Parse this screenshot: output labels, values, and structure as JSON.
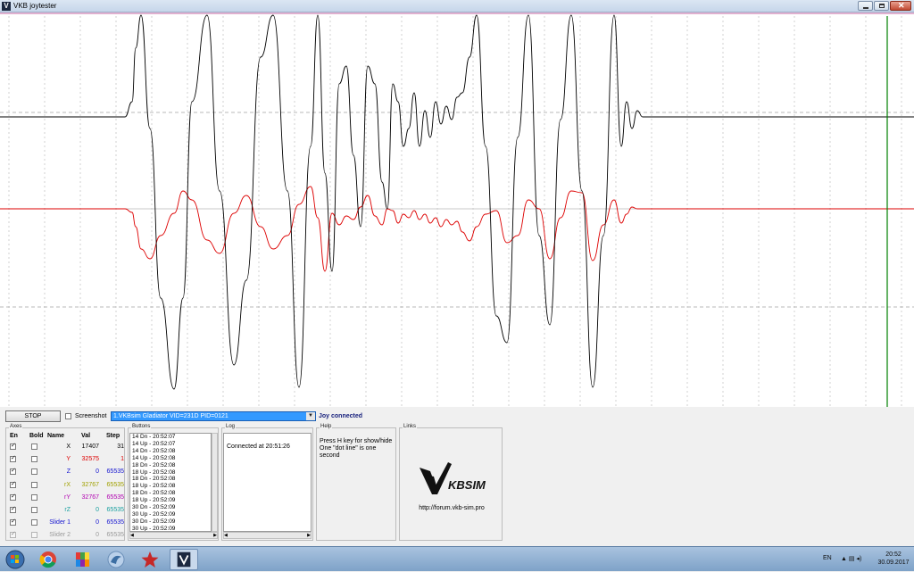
{
  "window": {
    "title": "VKB joytester"
  },
  "plot": {
    "trace_colors": {
      "x": "#000000",
      "y": "#dd0000"
    },
    "cursor_color": "#008000"
  },
  "controls": {
    "stop_label": "STOP",
    "screenshot_label": "Screenshot",
    "screenshot_checked": false,
    "device": "1.VKBsim Gladiator  VID=231D PID=0121",
    "status": "Joy connected",
    "status_color": "#1a237e"
  },
  "axes": {
    "legend": "Axes",
    "headers": {
      "en": "En",
      "bold": "Bold",
      "name": "Name",
      "val": "Val",
      "step": "Step"
    },
    "rows": [
      {
        "name": "X",
        "val": "17407",
        "step": "31",
        "en": true,
        "bold": false,
        "color": "#000000"
      },
      {
        "name": "Y",
        "val": "32575",
        "step": "1",
        "en": true,
        "bold": false,
        "color": "#dd0000"
      },
      {
        "name": "Z",
        "val": "0",
        "step": "65535",
        "en": true,
        "bold": false,
        "color": "#1515d0"
      },
      {
        "name": "rX",
        "val": "32767",
        "step": "65535",
        "en": true,
        "bold": false,
        "color": "#a0a000"
      },
      {
        "name": "rY",
        "val": "32767",
        "step": "65535",
        "en": true,
        "bold": false,
        "color": "#b000b0"
      },
      {
        "name": "rZ",
        "val": "0",
        "step": "65535",
        "en": true,
        "bold": false,
        "color": "#1aa0a0"
      },
      {
        "name": "Slider 1",
        "val": "0",
        "step": "65535",
        "en": true,
        "bold": false,
        "color": "#1515d0"
      },
      {
        "name": "Slider 2",
        "val": "0",
        "step": "65535",
        "en": true,
        "bold": false,
        "color": "#9a9a9a"
      }
    ]
  },
  "buttons": {
    "legend": "Buttons",
    "events": [
      "14 Dn - 20:52:07",
      "14 Up - 20:52:07",
      "14 Dn - 20:52:08",
      "14 Up - 20:52:08",
      "18 Dn - 20:52:08",
      "18 Up - 20:52:08",
      "18 Dn - 20:52:08",
      "18 Up - 20:52:08",
      "18 Dn - 20:52:08",
      "18 Up - 20:52:09",
      "30 Dn - 20:52:09",
      "30 Up - 20:52:09",
      "30 Dn - 20:52:09",
      "30 Up - 20:52:09"
    ]
  },
  "log": {
    "legend": "Log",
    "text": "Connected at 20:51:26"
  },
  "help": {
    "legend": "Help",
    "line1": "Press H key for show/hide",
    "line2": "One \"dot line\" is one second"
  },
  "links": {
    "legend": "Links",
    "logo_text": "KBSIM",
    "url": "http://forum.vkb-sim.pro"
  },
  "taskbar": {
    "lang": "EN",
    "time": "20:52",
    "date": "30.09.2017"
  }
}
